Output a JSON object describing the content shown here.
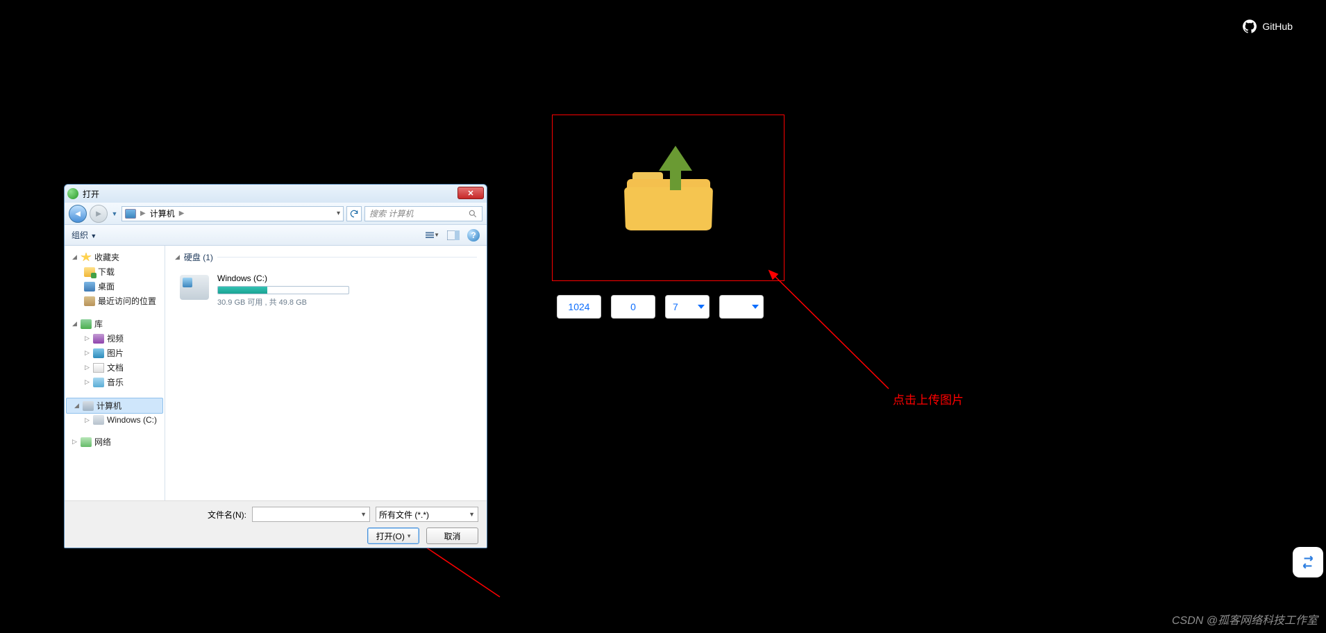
{
  "github": {
    "label": "GitHub"
  },
  "upload": {
    "annotation": "点击上传图片",
    "params": {
      "wh": "1024",
      "pos": "0",
      "level": "7",
      "option": ""
    }
  },
  "dialog": {
    "title": "打开",
    "breadcrumb": {
      "root": "计算机",
      "sep": "▶"
    },
    "search_placeholder": "搜索 计算机",
    "toolbar": {
      "organize": "组织",
      "organize_caret": "▼"
    },
    "tree": {
      "favorites": "收藏夹",
      "downloads": "下载",
      "desktop": "桌面",
      "recent": "最近访问的位置",
      "libraries": "库",
      "videos": "视频",
      "pictures": "图片",
      "documents": "文档",
      "music": "音乐",
      "computer": "计算机",
      "drive_c": "Windows (C:)",
      "network": "网络"
    },
    "content": {
      "group_hd": "硬盘 (1)",
      "drive": {
        "name": "Windows (C:)",
        "free_used_text": "30.9 GB 可用 , 共 49.8 GB",
        "fill_pct": 38
      }
    },
    "bottom": {
      "filename_label": "文件名(N):",
      "filetype_value": "所有文件 (*.*)",
      "open": "打开(O)",
      "cancel": "取消"
    }
  },
  "watermark": "CSDN @孤客网络科技工作室"
}
